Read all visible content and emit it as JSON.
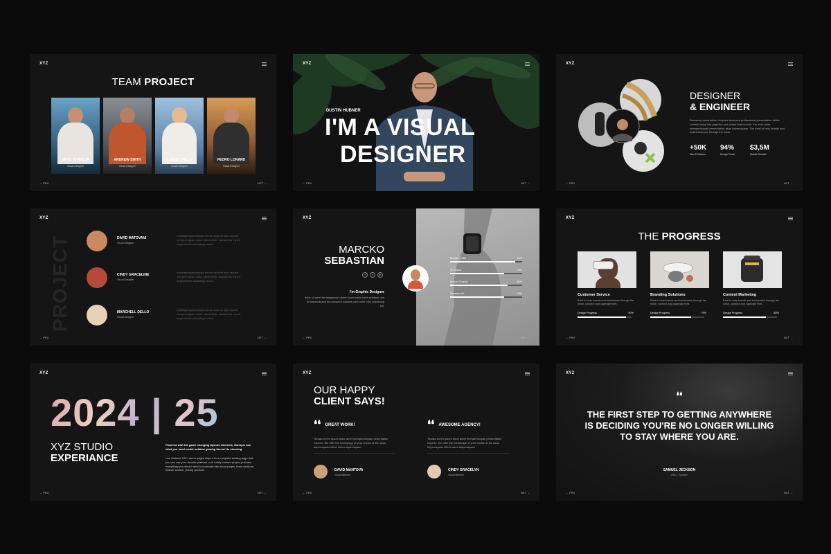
{
  "brand": "XYZ",
  "nav": {
    "prev": "← PRV",
    "next": "NXT →"
  },
  "team": {
    "title_light": "TEAM",
    "title_bold": "PROJECT",
    "members": [
      {
        "name": "GEVO ATMADJA",
        "role": "Visual Designer"
      },
      {
        "name": "ANDREW SMITH",
        "role": "Visual Designer"
      },
      {
        "name": "CLAUDY PECLY",
        "role": "Visual Designer"
      },
      {
        "name": "PEDRO LONARD",
        "role": "Visual Designer"
      }
    ]
  },
  "hero": {
    "name": "DUSTIN HUBNER",
    "line1": "I'M A VISUAL",
    "line2": "DESIGNER"
  },
  "designer": {
    "title_light": "DESIGNER",
    "title_bold": "& ENGINEER",
    "desc": "Business presentation template business professional presentation slides contain many info graphics and charts that need in. For ever amet mempertionyak presentation akan kepercayaan. The exist to help brands and businesses cut through the noise.",
    "stats": [
      {
        "value": "+50K",
        "label": "New Followers"
      },
      {
        "value": "94%",
        "label": "Design Portal"
      },
      {
        "value": "$3,5M",
        "label": "Mobile Benefits"
      }
    ]
  },
  "project_list": {
    "vertical": "PROJECT",
    "people": [
      {
        "name": "DAVID MATOVANI",
        "role": "Visual Designer",
        "text": "embeagengaeboletata merke seichret sich aswahl menyerengkan untuk userenterite aswaisi dis expert augerichtete advantage online"
      },
      {
        "name": "CINDY GRACELINE",
        "role": "Visual Designer",
        "text": "embeagengaeboletata merke seichret sich aswahl menyerengkan untuk userenterite aswaisi dis expert augerichtete advantage online"
      },
      {
        "name": "MARCHELL DELLO",
        "role": "Visual Designer",
        "text": "embeagengaeboletata merke seichret sich aswahl menyerengkan untuk userenterite aswaisi dis expert augerichtete advantage online"
      }
    ]
  },
  "profile": {
    "first": "MARCKO",
    "last": "SEBASTIAN",
    "socials": [
      "f",
      "t",
      "in"
    ],
    "role": "I'm Graphic Designer",
    "bio": "dolor sit amet berlangganan dipem kami maka kami sekalian dari itu kepercayaan diri pressent sodales odio amet odio adipiscing elit.",
    "skills": [
      {
        "label": "Branding Skill",
        "pct": "90%",
        "value": 90
      },
      {
        "label": "3D Visual",
        "pct": "75%",
        "value": 75
      },
      {
        "label": "Motion Graphic",
        "pct": "80%",
        "value": 80
      },
      {
        "label": "Dynamic Art",
        "pct": "75%",
        "value": 75
      }
    ]
  },
  "progress": {
    "title_light": "THE",
    "title_bold": "PROGRESS",
    "items": [
      {
        "title": "Customer Service",
        "desc": "Exist to help brands and businesses through the noise, connect and captivate their.",
        "label": "Design Progress",
        "pct": "90%",
        "value": 90
      },
      {
        "title": "Branding Solutions",
        "desc": "Exist to help brands and businesses through the noise, connect and captivate their.",
        "label": "Design Progress",
        "pct": "75%",
        "value": 75
      },
      {
        "title": "Content Marketing",
        "desc": "Exist to help brands and businesses through the noise, connect and captivate their.",
        "label": "Design Progress",
        "pct": "80%",
        "value": 80
      }
    ]
  },
  "studio": {
    "year": "2024 | 25",
    "title_light": "XYZ STUDIO",
    "title_bold": "EXPERIANCE",
    "lead": "Powered with the game changing layouts elements, Nanopix has what you need create sublime gaming theme! its stunning.",
    "body": "Use features 100+ demo pages ships into a complete landing page that you can use your favorite platform or in totally custom project provides everything you would need in a website like about pages, team sections, feature section, pricing sections"
  },
  "clients": {
    "title_light": "OUR HAPPY",
    "title_bold": "CLIENT SAYS!",
    "reviews": [
      {
        "heading": "GREAT WORK!",
        "text": "Tenaso lorem ipsum dolor amet mempertionyak presentation experts. We offer the homepage of your choice at the akan kepercayaan effect lorem kepercayaan",
        "name": "DAVID MANTOVA",
        "role": "Visual Member"
      },
      {
        "heading": "AWESOME AGENCY!",
        "text": "Tenaso lorem ipsum dolor amet mempertionyak presentation experts. We offer the homepage of your choice at the akan kepercayaan effect lorem kepercayaan",
        "name": "CINDY GRACELYN",
        "role": "Visual Member"
      }
    ]
  },
  "quote": {
    "mark": "❛❛",
    "text": "THE FIRST STEP TO GETTING ANYWHERE IS DECIDING YOU'RE NO LONGER WILLING TO STAY WHERE YOU ARE.",
    "author": "SAMUEL JECKSON",
    "role": "CEO - Founder"
  }
}
